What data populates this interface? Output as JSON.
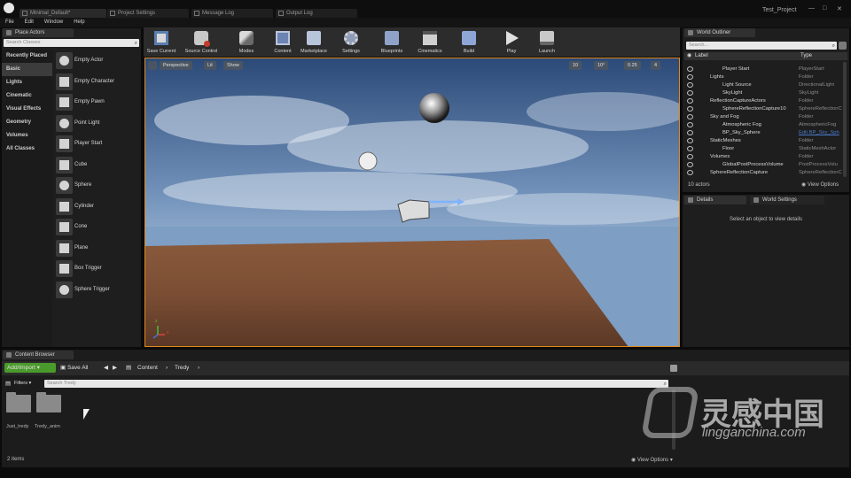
{
  "window": {
    "tabs": [
      "Minimal_Default*",
      "Project Settings",
      "Message Log",
      "Output Log"
    ],
    "project_name": "Test_Project",
    "controls": [
      "—",
      "□",
      "✕"
    ]
  },
  "menu": [
    "File",
    "Edit",
    "Window",
    "Help"
  ],
  "place_actors": {
    "tab_label": "Place Actors",
    "search_placeholder": "Search Classes",
    "categories": [
      "Recently Placed",
      "Basic",
      "Lights",
      "Cinematic",
      "Visual Effects",
      "Geometry",
      "Volumes",
      "All Classes"
    ],
    "selected_category": "Basic",
    "items": [
      "Empty Actor",
      "Empty Character",
      "Empty Pawn",
      "Point Light",
      "Player Start",
      "Cube",
      "Sphere",
      "Cylinder",
      "Cone",
      "Plane",
      "Box Trigger",
      "Sphere Trigger"
    ]
  },
  "toolbar": {
    "buttons": [
      "Save Current",
      "Source Control",
      "Modes",
      "Content",
      "Marketplace",
      "Settings",
      "Blueprints",
      "Cinematics",
      "Build",
      "Play",
      "Launch"
    ]
  },
  "viewport": {
    "perspective": "Perspective",
    "lit": "Lit",
    "show": "Show",
    "grid_snap": "10",
    "rotation_snap": "10°",
    "scale_snap": "0.25",
    "camera_speed": "4",
    "axis_x": "x",
    "axis_y": "y",
    "axis_z": "z"
  },
  "world_outliner": {
    "tab_label": "World Outliner",
    "search_placeholder": "Search...",
    "col_label": "Label",
    "col_type": "Type",
    "rows": [
      {
        "name": "Player Start",
        "type": "PlayerStart",
        "indent": 2
      },
      {
        "name": "Lights",
        "type": "Folder",
        "indent": 1
      },
      {
        "name": "Light Source",
        "type": "DirectionalLight",
        "indent": 2
      },
      {
        "name": "SkyLight",
        "type": "SkyLight",
        "indent": 2
      },
      {
        "name": "ReflectionCaptureActors",
        "type": "Folder",
        "indent": 1
      },
      {
        "name": "SphereReflectionCapture10",
        "type": "SphereReflectionC",
        "indent": 2
      },
      {
        "name": "Sky and Fog",
        "type": "Folder",
        "indent": 1
      },
      {
        "name": "Atmospheric Fog",
        "type": "AtmosphericFog",
        "indent": 2
      },
      {
        "name": "BP_Sky_Sphere",
        "type": "Edit BP_Sky_Sph",
        "indent": 2
      },
      {
        "name": "StaticMeshes",
        "type": "Folder",
        "indent": 1
      },
      {
        "name": "Floor",
        "type": "StaticMeshActor",
        "indent": 2
      },
      {
        "name": "Volumes",
        "type": "Folder",
        "indent": 1
      },
      {
        "name": "GlobalPostProcessVolume",
        "type": "PostProcessVolu",
        "indent": 2
      },
      {
        "name": "SphereReflectionCapture",
        "type": "SphereReflectionC",
        "indent": 1
      }
    ],
    "actor_count": "10 actors",
    "view_options": "View Options"
  },
  "details": {
    "tab_label": "Details",
    "world_settings_tab": "World Settings",
    "empty_message": "Select an object to view details"
  },
  "content_browser": {
    "tab_label": "Content Browser",
    "add_import": "Add/Import",
    "save_all": "Save All",
    "path": [
      "Content",
      "Tredy"
    ],
    "filters": "Filters",
    "search_placeholder": "Search Tredy",
    "folders": [
      "Just_tredy",
      "Tredy_anim"
    ],
    "item_count": "2 items",
    "view_options": "View Options"
  },
  "watermark": {
    "brand_cn": "灵感中国",
    "brand_url": "lingganchina.com"
  },
  "colors": {
    "accent_orange": "#e08a1c",
    "add_import_green": "#4a9a2b",
    "selection_blue": "#4a78c8"
  }
}
